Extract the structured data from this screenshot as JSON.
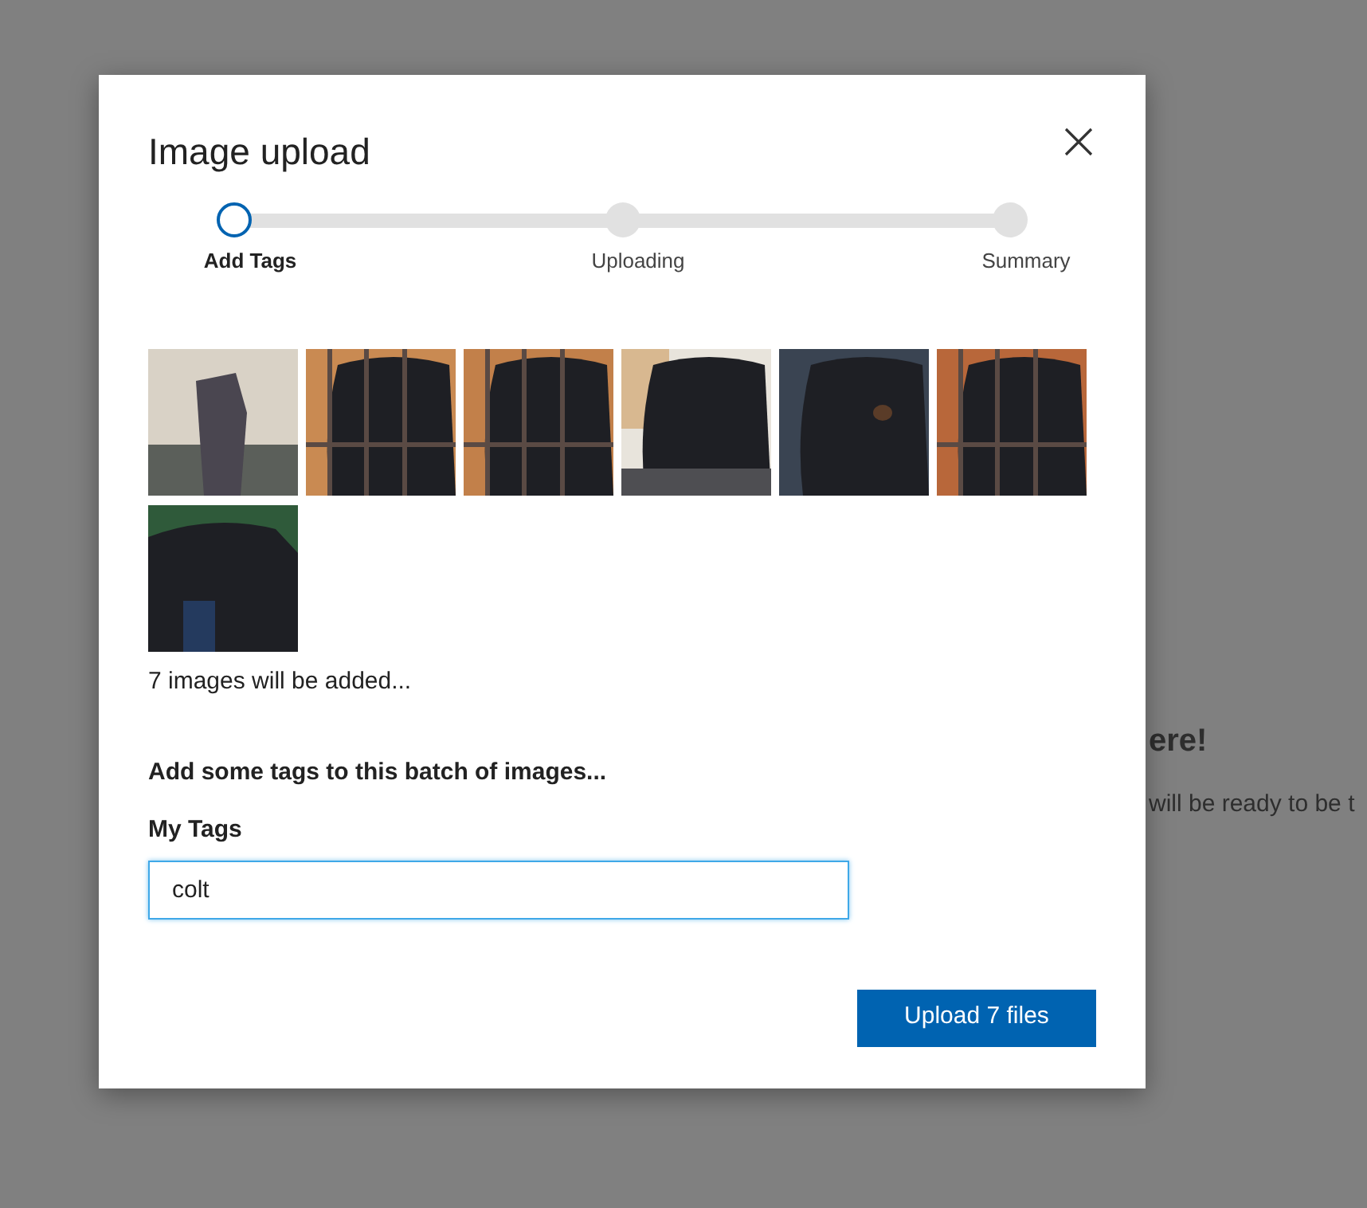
{
  "background": {
    "heading": "ere!",
    "text": "will be ready to be t"
  },
  "dialog": {
    "title": "Image upload",
    "steps": [
      {
        "label": "Add Tags",
        "selected": true
      },
      {
        "label": "Uploading",
        "selected": false
      },
      {
        "label": "Summary",
        "selected": false
      }
    ],
    "count_text": "7 images will be added...",
    "tags_prompt": "Add some tags to this batch of images...",
    "tags_field": {
      "label": "My Tags",
      "value": "colt"
    },
    "upload_button": "Upload 7 files"
  }
}
